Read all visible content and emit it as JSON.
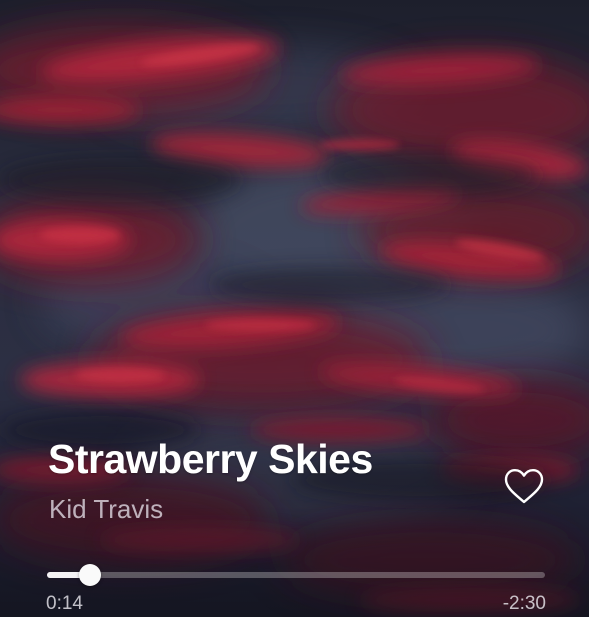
{
  "track": {
    "title": "Strawberry Skies",
    "artist": "Kid Travis"
  },
  "playback": {
    "elapsed": "0:14",
    "remaining": "-2:30",
    "progress_fraction": 0.0854
  },
  "icons": {
    "like": "heart-outline-icon"
  },
  "colors": {
    "sky_dark": "#1f2231",
    "cloud_red": "#b3283c",
    "cloud_crimson": "#8c1c2e",
    "text_primary": "#ffffff",
    "text_secondary": "#c9c4cc"
  }
}
